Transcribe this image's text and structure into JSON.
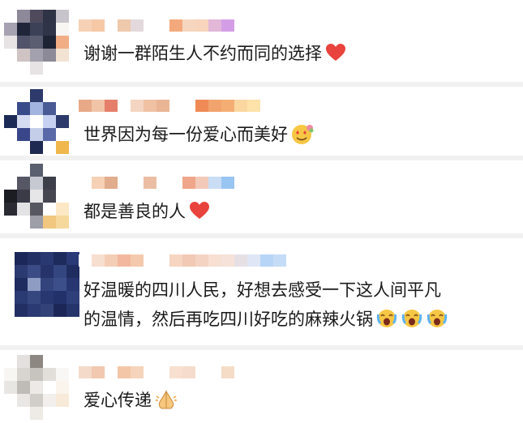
{
  "comments": [
    {
      "text": "谢谢一群陌生人不约而同的选择",
      "emojis": [
        "heart-icon"
      ],
      "name_colors": [
        "#f6d1b5",
        "#f6c8a6",
        "#ffffff",
        "#efc9ac",
        "#e3d9dc",
        "#ffffff",
        "#ffffff",
        "#f3a97c",
        "#f6d6bf",
        "#f7d4bb",
        "#e2b7d8",
        "#d49ee6"
      ],
      "avatar_colors": [
        "#ffffff",
        "#8e8999",
        "#4e4a5c",
        "#2e3345",
        "#c8c4cc",
        "#a7a2b1",
        "#20253a",
        "#3c4158",
        "#2f3449",
        "#f8f6f2",
        "#e8e3e5",
        "#505369",
        "#5b5d70",
        "#1f2434",
        "#f1ae84",
        "#ffffff",
        "#cfc3c3",
        "#a4a1ae",
        "#8c8998",
        "#f2e3d3",
        "#ffffff",
        "#ffffff",
        "#e7e2e4",
        "#ffffff",
        "#ffffff"
      ]
    },
    {
      "text": "世界因为每一份爱心而美好",
      "emojis": [
        "heart-eyes-face-icon"
      ],
      "name_colors": [
        "#e7a987",
        "#f1c4a8",
        "#e67f69",
        "#ffffff",
        "#f3d5c1",
        "#f0c1a3",
        "#e9b595",
        "#ffffff",
        "#ffffff",
        "#f08a56",
        "#f3a36e",
        "#f4ae73",
        "#fbd7a0",
        "#fde3a9"
      ],
      "avatar_colors": [
        "#ffffff",
        "#ffffff",
        "#2d3a6b",
        "#ffffff",
        "#ffffff",
        "#ffffff",
        "#3a4b8a",
        "#a4b4e1",
        "#4a5a95",
        "#ffffff",
        "#1b2b55",
        "#d5dbf0",
        "#ffffff",
        "#c6d1f2",
        "#2c3a6b",
        "#ffffff",
        "#39478a",
        "#c5cee9",
        "#5a69a8",
        "#ffffff",
        "#ffffff",
        "#ffffff",
        "#1e2a52",
        "#ffffff",
        "#f0b74d"
      ]
    },
    {
      "text": "都是善良的人",
      "emojis": [
        "heart-icon"
      ],
      "name_colors": [
        "#ffffff",
        "#f6d1b5",
        "#e2ad8c",
        "#ffffff",
        "#ffffff",
        "#ebbea3",
        "#ffffff",
        "#ffffff",
        "#f0a68a",
        "#f3c9b9",
        "#c9ddf5",
        "#99c5f3"
      ],
      "avatar_colors": [
        "#ffffff",
        "#ffffff",
        "#5b6070",
        "#ffffff",
        "#ffffff",
        "#ffffff",
        "#555765",
        "#c6c9d2",
        "#3c3e4a",
        "#ffffff",
        "#1c1c23",
        "#3a3b47",
        "#e6e6e8",
        "#454650",
        "#ffffff",
        "#2a2a33",
        "#e3e3e5",
        "#56575f",
        "#ffffff",
        "#fce8c4",
        "#ffffff",
        "#ffffff",
        "#9d9ea8",
        "#f1c780",
        "#f5d89c"
      ]
    },
    {
      "text_lines": [
        "好温暖的四川人民，好想去感受一下这人间平凡",
        "的温情，然后再吃四川好吃的麻辣火锅"
      ],
      "emojis": [
        "tears-of-joy-face-icon",
        "tears-of-joy-face-icon",
        "tears-of-joy-face-icon"
      ],
      "name_colors": [
        "#ffffff",
        "#f7dfcf",
        "#f4cdb6",
        "#f2b79e",
        "#f5c9ad",
        "#ffffff",
        "#ffffff",
        "#f6d5c1",
        "#f1c9b5",
        "#f4d3c2",
        "#f7e0d2",
        "#f6e2d8",
        "#e6e0e5",
        "#dfe7f6",
        "#b7d5f7",
        "#c5dcf6"
      ],
      "avatar_colors": [
        "#1b2758",
        "#223064",
        "#2a3871",
        "#1d2a5c",
        "#2a3a77",
        "#2c3a72",
        "#3b4b85",
        "#25336a",
        "#34467f",
        "#1f2c60",
        "#1f2c60",
        "#8e9cc3",
        "#33447c",
        "#3d4f8a",
        "#273570",
        "#2a3a72",
        "#36467f",
        "#283770",
        "#23316a",
        "#2f3f79",
        "#222f63",
        "#2b3a72",
        "#334379",
        "#1c2758",
        "#26346c"
      ]
    },
    {
      "text": "爱心传递",
      "emojis": [
        "folded-hands-icon"
      ],
      "name_colors": [
        "#f3dac9",
        "#f1c9b0",
        "#ffffff",
        "#f3c6a8",
        "#f6d4bb",
        "#ffffff",
        "#ffffff",
        "#f7e0d0",
        "#f6dccc",
        "#ffffff",
        "#ffffff",
        "#f4dcc6"
      ],
      "avatar_colors": [
        "#ffffff",
        "#e3e0dd",
        "#8d8881",
        "#ffffff",
        "#ffffff",
        "#f7f6f3",
        "#d8d5d1",
        "#c7c3bf",
        "#e2dfdb",
        "#f8f7f5",
        "#e8e6e3",
        "#bfbcb7",
        "#ece9e6",
        "#ffffff",
        "#fbf4ec",
        "#ffffff",
        "#e9e7e3",
        "#d1cec9",
        "#f2efec",
        "#f7ead8",
        "#ffffff",
        "#ffffff",
        "#eeeae6",
        "#ffffff",
        "#ffffff"
      ]
    }
  ]
}
